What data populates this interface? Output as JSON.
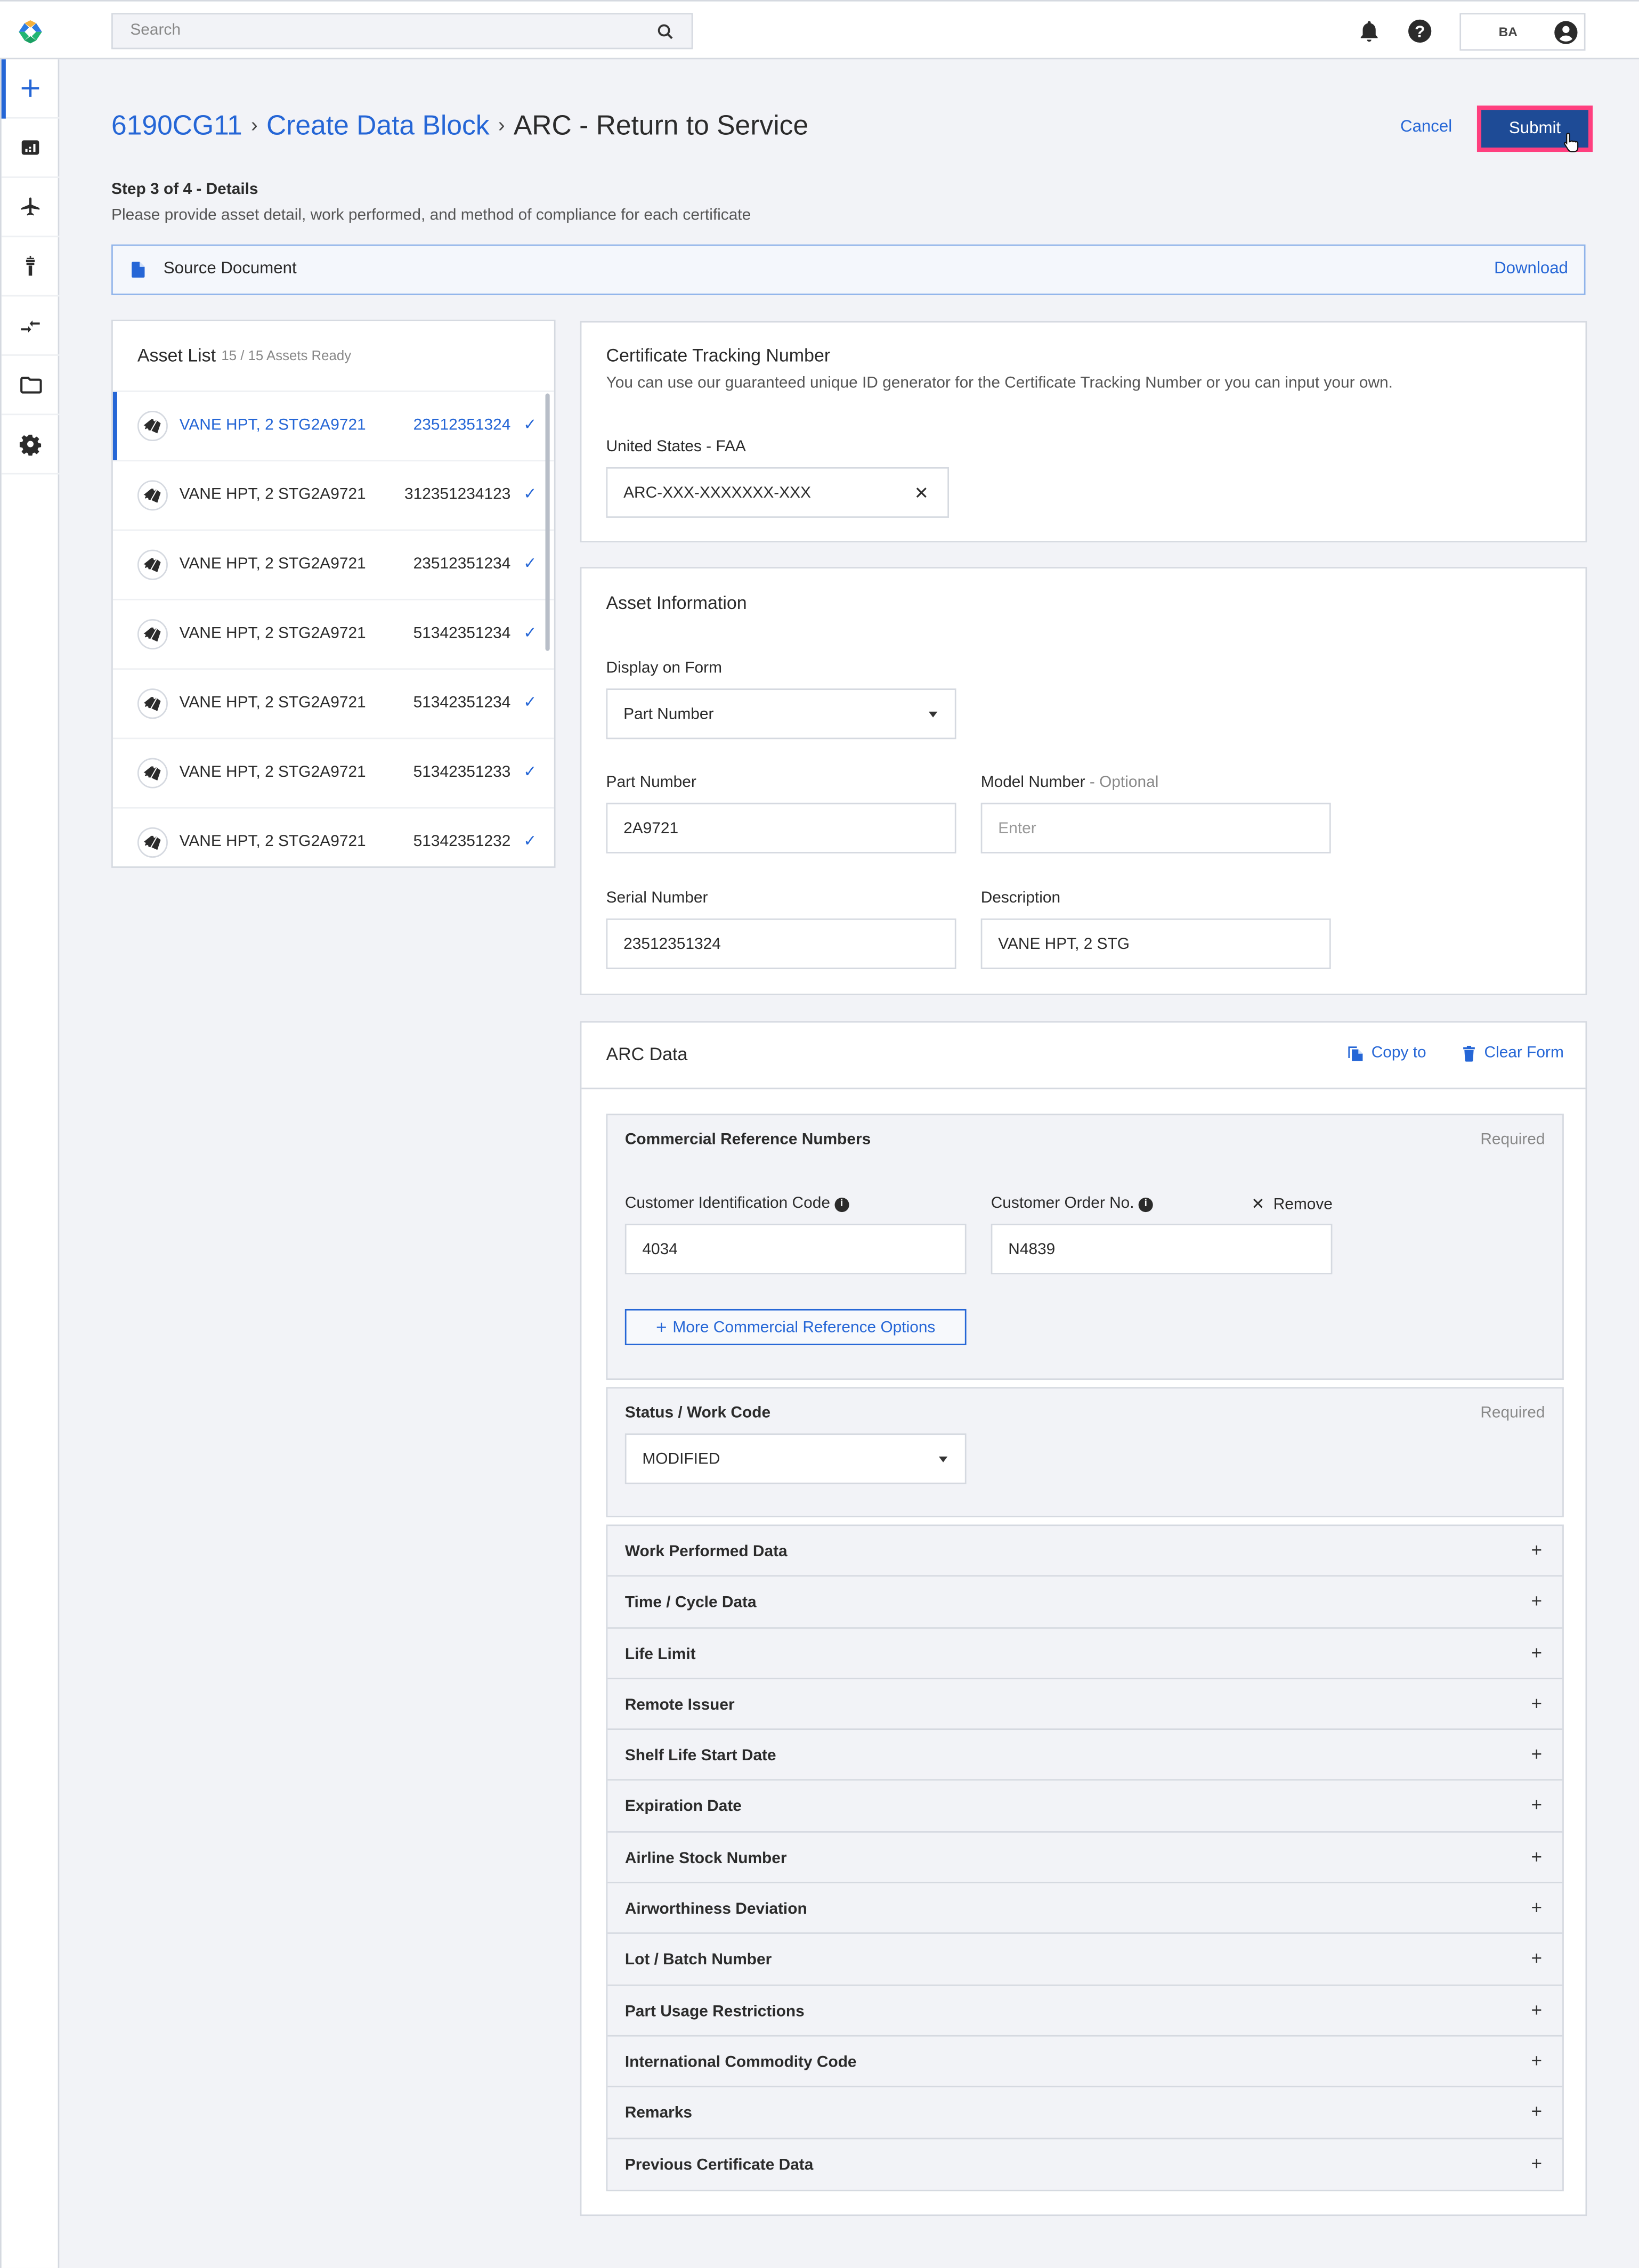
{
  "topbar": {
    "search_placeholder": "Search",
    "user_initials": "BA"
  },
  "sidebar": {
    "items": [
      {
        "icon": "plus-icon",
        "label": "Create",
        "active": true
      },
      {
        "icon": "dashboard-chart-icon",
        "label": "Dashboard"
      },
      {
        "icon": "airplane-icon",
        "label": "Aircraft"
      },
      {
        "icon": "control-tower-icon",
        "label": "Airport"
      },
      {
        "icon": "transfer-arrows-icon",
        "label": "Transfers"
      },
      {
        "icon": "folder-icon",
        "label": "Files"
      },
      {
        "icon": "gear-icon",
        "label": "Settings"
      }
    ]
  },
  "header": {
    "breadcrumb": [
      "6190CG11",
      "Create Data Block",
      "ARC - Return to Service"
    ],
    "cancel_label": "Cancel",
    "submit_label": "Submit",
    "step_title": "Step 3 of 4 - Details",
    "step_description": "Please provide asset detail, work performed, and method of compliance for each certificate"
  },
  "source_document": {
    "label": "Source Document",
    "download_label": "Download"
  },
  "asset_list": {
    "title": "Asset List",
    "status": "15 / 15 Assets Ready",
    "rows": [
      {
        "description": "VANE HPT, 2 STG",
        "part_number": "2A9721",
        "serial_number": "23512351324",
        "ready": true,
        "selected": true
      },
      {
        "description": "VANE HPT, 2 STG",
        "part_number": "2A9721",
        "serial_number": "312351234123",
        "ready": true
      },
      {
        "description": "VANE HPT, 2 STG",
        "part_number": "2A9721",
        "serial_number": "23512351234",
        "ready": true
      },
      {
        "description": "VANE HPT, 2 STG",
        "part_number": "2A9721",
        "serial_number": "51342351234",
        "ready": true
      },
      {
        "description": "VANE HPT, 2 STG",
        "part_number": "2A9721",
        "serial_number": "51342351234",
        "ready": true
      },
      {
        "description": "VANE HPT, 2 STG",
        "part_number": "2A9721",
        "serial_number": "51342351233",
        "ready": true
      },
      {
        "description": "VANE HPT, 2 STG",
        "part_number": "2A9721",
        "serial_number": "51342351232",
        "ready": true
      }
    ],
    "check_glyph": "✓"
  },
  "certificate_tracking": {
    "title": "Certificate Tracking Number",
    "description": "You can use our guaranteed unique ID generator for the Certificate Tracking Number or you can input your own.",
    "field_label": "United States - FAA",
    "field_value": "ARC-XXX-XXXXXXX-XXX"
  },
  "asset_information": {
    "title": "Asset Information",
    "display_on_form_label": "Display on Form",
    "display_on_form_value": "Part Number",
    "part_number_label": "Part Number",
    "part_number_value": "2A9721",
    "model_number_label": "Model Number",
    "model_number_optional": " - Optional",
    "model_number_placeholder": "Enter",
    "serial_number_label": "Serial Number",
    "serial_number_value": "23512351324",
    "description_label": "Description",
    "description_value": "VANE HPT, 2 STG"
  },
  "arc_data": {
    "title": "ARC Data",
    "copy_to_label": "Copy to",
    "clear_form_label": "Clear Form",
    "commercial_reference": {
      "title": "Commercial Reference Numbers",
      "required_label": "Required",
      "customer_id_label": "Customer Identification Code",
      "customer_id_value": "4034",
      "customer_order_label": "Customer Order No.",
      "customer_order_value": "N4839",
      "remove_label": "Remove",
      "more_options_label": "More Commercial Reference Options"
    },
    "status_work_code": {
      "title": "Status / Work Code",
      "required_label": "Required",
      "value": "MODIFIED"
    },
    "collapsed_sections": [
      "Work Performed Data",
      "Time / Cycle Data",
      "Life Limit",
      "Remote Issuer",
      "Shelf Life Start Date",
      "Expiration Date",
      "Airline Stock Number",
      "Airworthiness Deviation",
      "Lot / Batch Number",
      "Part Usage Restrictions",
      "International Commodity Code",
      "Remarks",
      "Previous Certificate Data"
    ]
  },
  "colors": {
    "accent": "#2566d6",
    "submit_bg": "#1e4b96",
    "submit_highlight": "#ff3f7f",
    "page_bg": "#f2f3f7",
    "border": "#d5d9e0"
  }
}
